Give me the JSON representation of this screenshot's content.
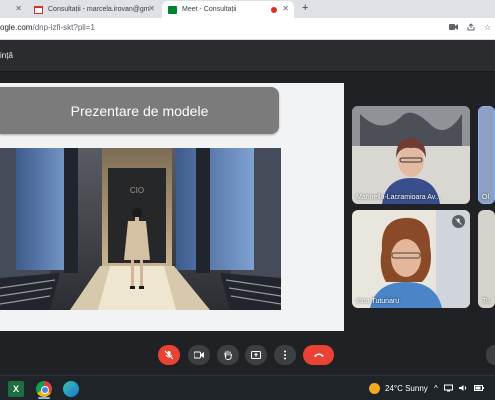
{
  "browser": {
    "tabs": [
      {
        "label": "",
        "icon": "page-icon"
      },
      {
        "label": "Consultații - marcela.irovan@gm",
        "icon": "gmail-icon"
      },
      {
        "label": "Meet - Consultații",
        "icon": "meet-icon",
        "active": true,
        "recording": true
      }
    ],
    "new_tab_label": "+",
    "url_host": "ogle.com",
    "url_path": "/dnp-izfi-skt?pli=1"
  },
  "meet": {
    "header_title": "ință",
    "presentation": {
      "slide_title": "Prezentare de modele",
      "photo_sign": "CIO"
    },
    "participants": [
      {
        "name": "Marinella-Lacramioara Av...",
        "muted": false
      },
      {
        "name": "Ol",
        "muted": false
      },
      {
        "name": "Irina Tutunaru",
        "muted": true
      },
      {
        "name": "Tu",
        "muted": false
      }
    ],
    "controls": {
      "mic": "muted",
      "end_call_color": "#ea4335"
    }
  },
  "taskbar": {
    "apps": [
      "excel-icon",
      "chrome-icon",
      "edge-icon"
    ],
    "excel_letter": "X",
    "weather": "24°C  Sunny"
  },
  "colors": {
    "meet_background": "#202124",
    "control_gray": "#3c4043",
    "control_red": "#ea4335",
    "slide_title_bg": "#7b7b7b"
  }
}
